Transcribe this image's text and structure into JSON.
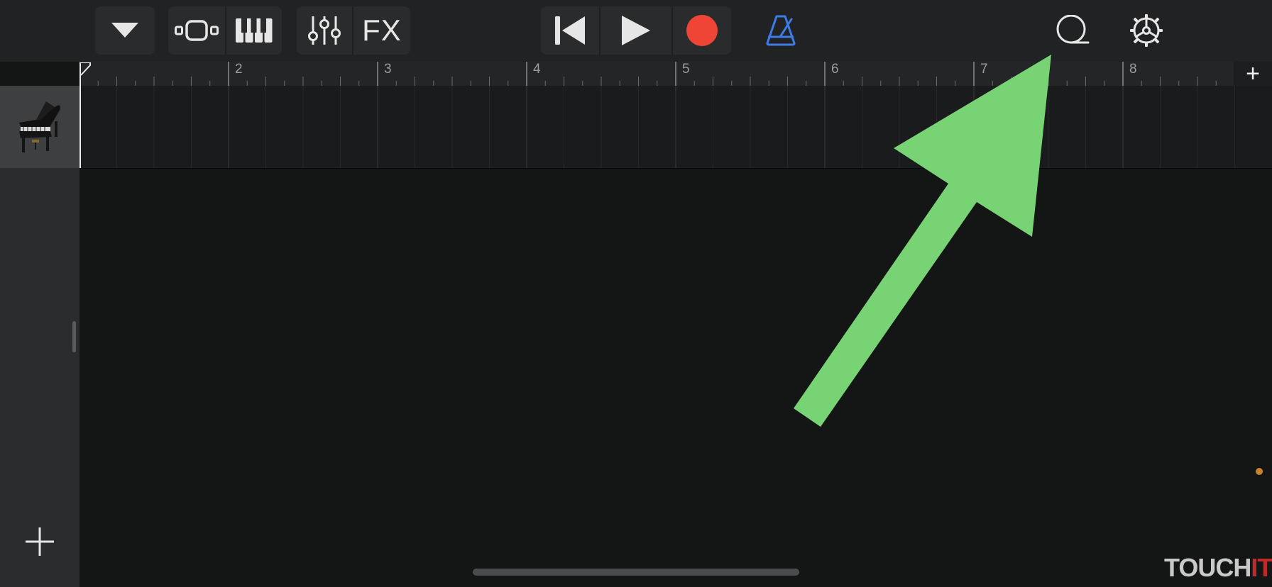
{
  "toolbar": {
    "fx_label": "FX",
    "icons": {
      "browser": "chevron-down-icon",
      "tracks_view": "tracks-view-icon",
      "instrument": "piano-keys-icon",
      "mixer": "sliders-icon",
      "rewind": "go-to-beginning-icon",
      "play": "play-icon",
      "record": "record-icon",
      "metronome": "metronome-icon",
      "loops": "loop-icon",
      "settings": "gear-icon"
    },
    "colors": {
      "record": "#ee4537",
      "metronome": "#3d7ce6"
    }
  },
  "ruler": {
    "bar_numbers": [
      "2",
      "3",
      "4",
      "5",
      "6",
      "7",
      "8"
    ],
    "add_section_label": "+"
  },
  "tracks": [
    {
      "instrument_icon": "grand-piano-icon"
    }
  ],
  "add_track_icon": "plus-icon",
  "overlay": {
    "arrow_color": "#77d373"
  },
  "watermark": {
    "main": "TOUCH",
    "accent": "IT"
  }
}
